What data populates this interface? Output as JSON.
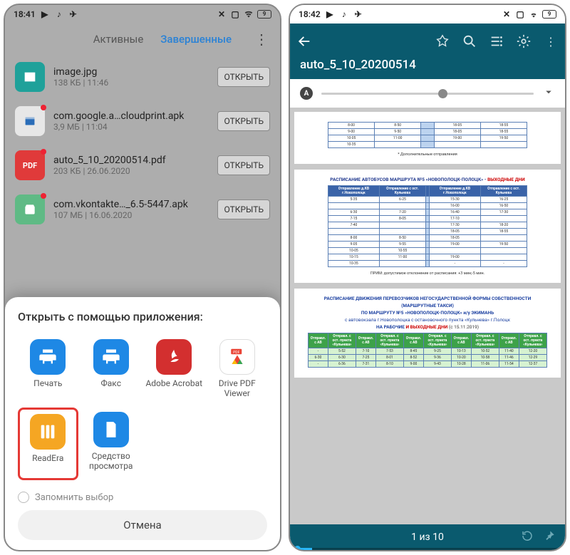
{
  "left": {
    "status_time": "18:41",
    "tabs": {
      "active": "Активные",
      "done": "Завершенные"
    },
    "open_label": "ОТКРЫТЬ",
    "files": [
      {
        "name": "image.jpg",
        "meta": "138 КБ | 11:46",
        "color": "#1fa19a"
      },
      {
        "name": "com.google.a…cloudprint.apk",
        "meta": "3,9 МБ | 11:04",
        "color": "#e7e7e7"
      },
      {
        "name": "auto_5_10_20200514.pdf",
        "meta": "203 КБ | 26.06.2020",
        "color": "#e03a3a"
      },
      {
        "name": "com.vkontakte…_6.5-5447.apk",
        "meta": "107 МБ | 16.06.2020",
        "color": "#5fba85"
      }
    ],
    "sheet": {
      "title": "Открыть с помощью приложения:",
      "apps": [
        {
          "label": "Печать",
          "icon": "printer",
          "bg": "#1e88e5"
        },
        {
          "label": "Факс",
          "icon": "printer",
          "bg": "#1e88e5"
        },
        {
          "label": "Adobe Acrobat",
          "icon": "acrobat",
          "bg": "#d32f2f"
        },
        {
          "label": "Drive PDF Viewer",
          "icon": "drive-pdf",
          "bg": "#fff"
        },
        {
          "label": "ReadEra",
          "icon": "readera",
          "bg": "#f5a623",
          "highlight": true
        },
        {
          "label": "Средство просмотра",
          "icon": "doc",
          "bg": "#1e88e5"
        }
      ],
      "remember": "Запомнить выбор",
      "cancel": "Отмена"
    }
  },
  "right": {
    "status_time": "18:42",
    "doc_title": "auto_5_10_20200514",
    "pager": "1 из 10",
    "page1": {
      "rows": [
        [
          "8-00",
          "8-50",
          "",
          "18-05",
          "18-55"
        ],
        [
          "9-00",
          "9-50",
          "",
          "18-05",
          "18-55"
        ],
        [
          "10-05",
          "11-00",
          "",
          "19-00",
          "19-50"
        ],
        [
          "10-35",
          "",
          "",
          "",
          ""
        ]
      ],
      "note": "* Дополнительные отправления"
    },
    "page2": {
      "title_a": "РАСПИСАНИЕ АВТОБУСОВ МАРШРУТА №5 «НОВОПОЛОЦК-ПОЛОЦК» - ",
      "title_b": "ВЫХОДНЫЕ ДНИ",
      "headers": [
        "Отправление д.КВ г.Новополоцк",
        "Отправление с ост. Кульнева",
        "",
        "Отправление д.КВ г.Новополоцк",
        "Отправление с ост. Кульнева"
      ],
      "rows": [
        [
          "5-35",
          "6-25",
          "",
          "15-30",
          "16-25"
        ],
        [
          "",
          "",
          "",
          "16-00",
          "16-50"
        ],
        [
          "6-30",
          "7-20",
          "",
          "16-40",
          "17-30"
        ],
        [
          "7-15",
          "8-05",
          "",
          "17-10",
          ""
        ],
        [
          "7-40",
          "",
          "",
          "17-30",
          "18-20"
        ],
        [
          "",
          "",
          "",
          "18-05",
          "18-55"
        ],
        [
          "8-00",
          "8-50",
          "",
          "18-05",
          ""
        ],
        [
          "9-05",
          "9-55",
          "",
          "19-00",
          "19-50"
        ],
        [
          "10-05",
          "10-55",
          "",
          "",
          "  "
        ],
        [
          "10-15",
          "11-00",
          "",
          "19-00",
          ""
        ],
        [
          "10-35",
          "",
          "",
          "-",
          "-"
        ]
      ],
      "note": "ПРИМ: допустимое отклонение от расписания: +3 мин;-5 мин."
    },
    "page3": {
      "title1": "РАСПИСАНИЕ ДВИЖЕНИЯ ПЕРЕВОЗЧИКОВ НЕГОСУДАРСТВЕННОЙ ФОРМЫ СОБСТВЕННОСТИ",
      "title2": "(МАРШРУТНЫЕ ТАКСИ)",
      "title3": "ПО МАРШРУТУ №5 «НОВОПОЛОЦК-ПОЛОЦК» и/у ЭКИМАНЬ",
      "title4": "с автовокзала г.Новополоцка с остановочного пункта «Кульнева» г.Полоцк",
      "title5_a": "НА РАБОЧИЕ",
      "title5_b": " И ",
      "title5_c": "ВЫХОДНЫЕ ДНИ",
      "title5_d": " (с 15.11.2019)",
      "headers": [
        "Отправл. с АВ",
        "Отправл. с ост. пункта «Кульнева»",
        "Отправл. с АВ",
        "Отправл. с ост. пункта «Кульнева»",
        "Отправл. с АВ",
        "Отправл. с ост. пункта «Кульнева»",
        "Отправл. с АВ",
        "Отправл. с ост. пункта «Кульнева»",
        "Отправл. с АВ",
        "Отправл. с ост. пункта «Кульнева»"
      ],
      "rows": [
        [
          "-",
          "5-52",
          "7-10",
          "7-53",
          "8-45",
          "9-25",
          "10-13",
          "10-52",
          "11-40",
          "12-20"
        ],
        [
          "6-30",
          "6-30",
          "7-25",
          "8-01",
          "8-52",
          "9-36",
          "10-20",
          "10-58",
          "11-46",
          "12-29"
        ],
        [
          "-",
          "6-36",
          "7-31",
          "8-10",
          "9-00",
          "9-43",
          "10-28",
          "11-06",
          "11-54",
          "12-37"
        ]
      ]
    }
  }
}
